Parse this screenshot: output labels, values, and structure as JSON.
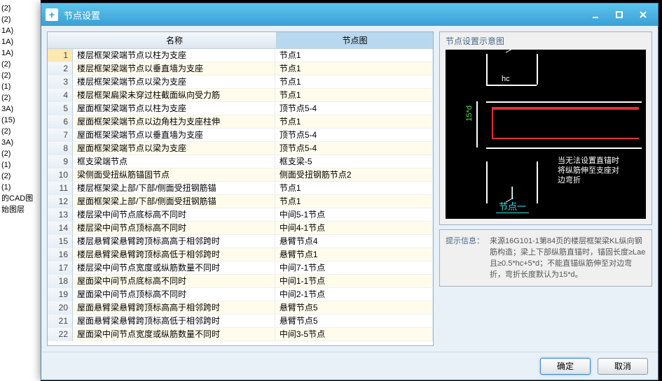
{
  "cad_sidebar": [
    "",
    "(2)",
    "(2)",
    "1A)",
    "1A)",
    "1A)",
    "",
    "(2)",
    "(2)",
    "(1)",
    "(2)",
    "3A)",
    "(15)",
    "(2)",
    "3A)",
    "(2)",
    "(1)",
    "(2)",
    "(1)",
    "",
    "的CAD图",
    "始图层"
  ],
  "dialog": {
    "title": "节点设置",
    "columns": {
      "name": "名称",
      "node": "节点图"
    },
    "rows": [
      {
        "n": 1,
        "name": "楼层框架梁端节点以柱为支座",
        "node": "节点1"
      },
      {
        "n": 2,
        "name": "楼层框架梁端节点以垂直墙为支座",
        "node": "节点1"
      },
      {
        "n": 3,
        "name": "楼层框架梁端节点以梁为支座",
        "node": "节点1"
      },
      {
        "n": 4,
        "name": "楼层框架扁梁未穿过柱截面纵向受力筋",
        "node": "节点1"
      },
      {
        "n": 5,
        "name": "屋面框架梁端节点以柱为支座",
        "node": "顶节点5-4"
      },
      {
        "n": 6,
        "name": "屋面框架梁端节点以边角柱为支座柱伸",
        "node": "节点1"
      },
      {
        "n": 7,
        "name": "屋面框架梁端节点以垂直墙为支座",
        "node": "顶节点5-4"
      },
      {
        "n": 8,
        "name": "屋面框架梁端节点以梁为支座",
        "node": "顶节点5-4"
      },
      {
        "n": 9,
        "name": "框支梁端节点",
        "node": "框支梁-5"
      },
      {
        "n": 10,
        "name": "梁侧面受扭纵筋锚固节点",
        "node": "侧面受扭钢筋节点2"
      },
      {
        "n": 11,
        "name": "楼层框架梁上部/下部/侧面受扭钢筋锚",
        "node": "节点1"
      },
      {
        "n": 12,
        "name": "屋面框架梁上部/下部/侧面受扭钢筋锚",
        "node": "节点1"
      },
      {
        "n": 13,
        "name": "楼层梁中间节点底标高不同时",
        "node": "中间5-1节点"
      },
      {
        "n": 14,
        "name": "楼层梁中间节点顶标高不同时",
        "node": "中间4-1节点"
      },
      {
        "n": 15,
        "name": "楼层悬臂梁悬臂跨顶标高高于相邻跨时",
        "node": "悬臂节点4"
      },
      {
        "n": 16,
        "name": "楼层悬臂梁悬臂跨顶标高低于相邻跨时",
        "node": "悬臂节点1"
      },
      {
        "n": 17,
        "name": "楼层梁中间节点宽度或纵筋数量不同时",
        "node": "中间7-1节点"
      },
      {
        "n": 18,
        "name": "屋面梁中间节点底标高不同时",
        "node": "中间1-1节点"
      },
      {
        "n": 19,
        "name": "屋面梁中间节点顶标高不同时",
        "node": "中间2-1节点"
      },
      {
        "n": 20,
        "name": "屋面悬臂梁悬臂跨顶标高高于相邻跨时",
        "node": "悬臂节点5"
      },
      {
        "n": 21,
        "name": "屋面悬臂梁悬臂跨顶标高低于相邻跨时",
        "node": "悬臂节点5"
      },
      {
        "n": 22,
        "name": "屋面梁中间节点宽度或纵筋数量不同时",
        "node": "中间3-5节点"
      }
    ],
    "selected_row": 1
  },
  "preview": {
    "title": "节点设置示意图",
    "labels": {
      "hc": "hc",
      "v": "15*d",
      "caption": "节点一",
      "note": "当无法设置直锚时\n将纵筋伸至支座对\n边弯折"
    }
  },
  "info": {
    "label": "提示信息：",
    "text": "来源16G101-1第84页的楼层框架梁KL纵向钢筋构造；梁上下部纵筋直锚时，锚固长度≥Lae且≥0.5*hc+5*d；不能直锚纵筋伸至对边弯折，弯折长度默认为15*d。"
  },
  "buttons": {
    "ok": "确定",
    "cancel": "取消"
  }
}
